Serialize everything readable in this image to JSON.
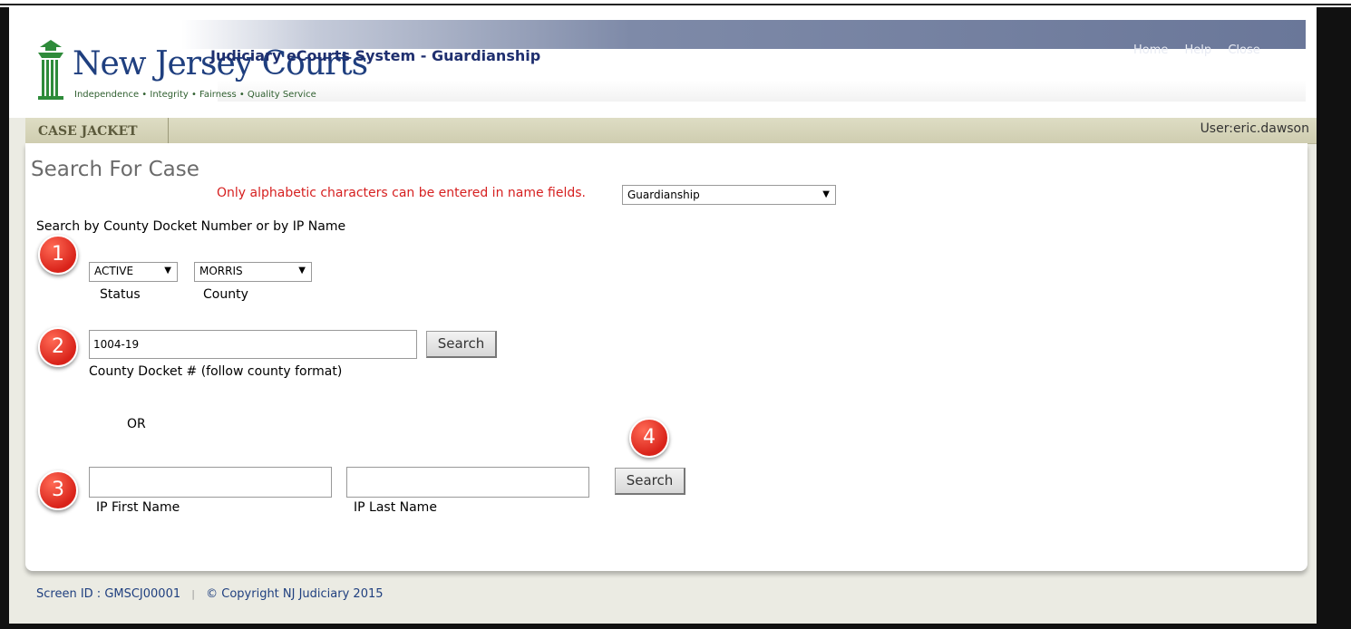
{
  "header": {
    "logo_title": "New Jersey Courts",
    "logo_tagline": "Independence • Integrity • Fairness • Quality Service",
    "system_title": "Judiciary eCourts System - Guardianship",
    "top_links": [
      "Home",
      "Help",
      "Close"
    ]
  },
  "nav": {
    "tab_label": "CASE JACKET",
    "user": "User:eric.dawson"
  },
  "main": {
    "title": "Search For Case",
    "warning": "Only alphabetic characters can be entered in name fields.",
    "case_type": "Guardianship",
    "instructions": "Search by County Docket Number or by IP Name",
    "status": {
      "value": "ACTIVE",
      "label": "Status"
    },
    "county": {
      "value": "MORRIS",
      "label": "County"
    },
    "docket": {
      "value": "1004-19",
      "label": "County Docket # (follow county format)"
    },
    "or_label": "OR",
    "first_name": {
      "value": "",
      "label": "IP First Name"
    },
    "last_name": {
      "value": "",
      "label": "IP Last Name"
    },
    "search_label": "Search",
    "markers": [
      "1",
      "2",
      "3",
      "4"
    ]
  },
  "footer": {
    "screen_id": "Screen ID : GMSCJ00001",
    "separator": "|",
    "copyright": "© Copyright NJ Judiciary 2015"
  },
  "colors": {
    "warning": "#d62020",
    "brand_blue": "#1f3f7f",
    "marker_red": "#d9231a",
    "nav_bg": "#cfcdb0"
  }
}
